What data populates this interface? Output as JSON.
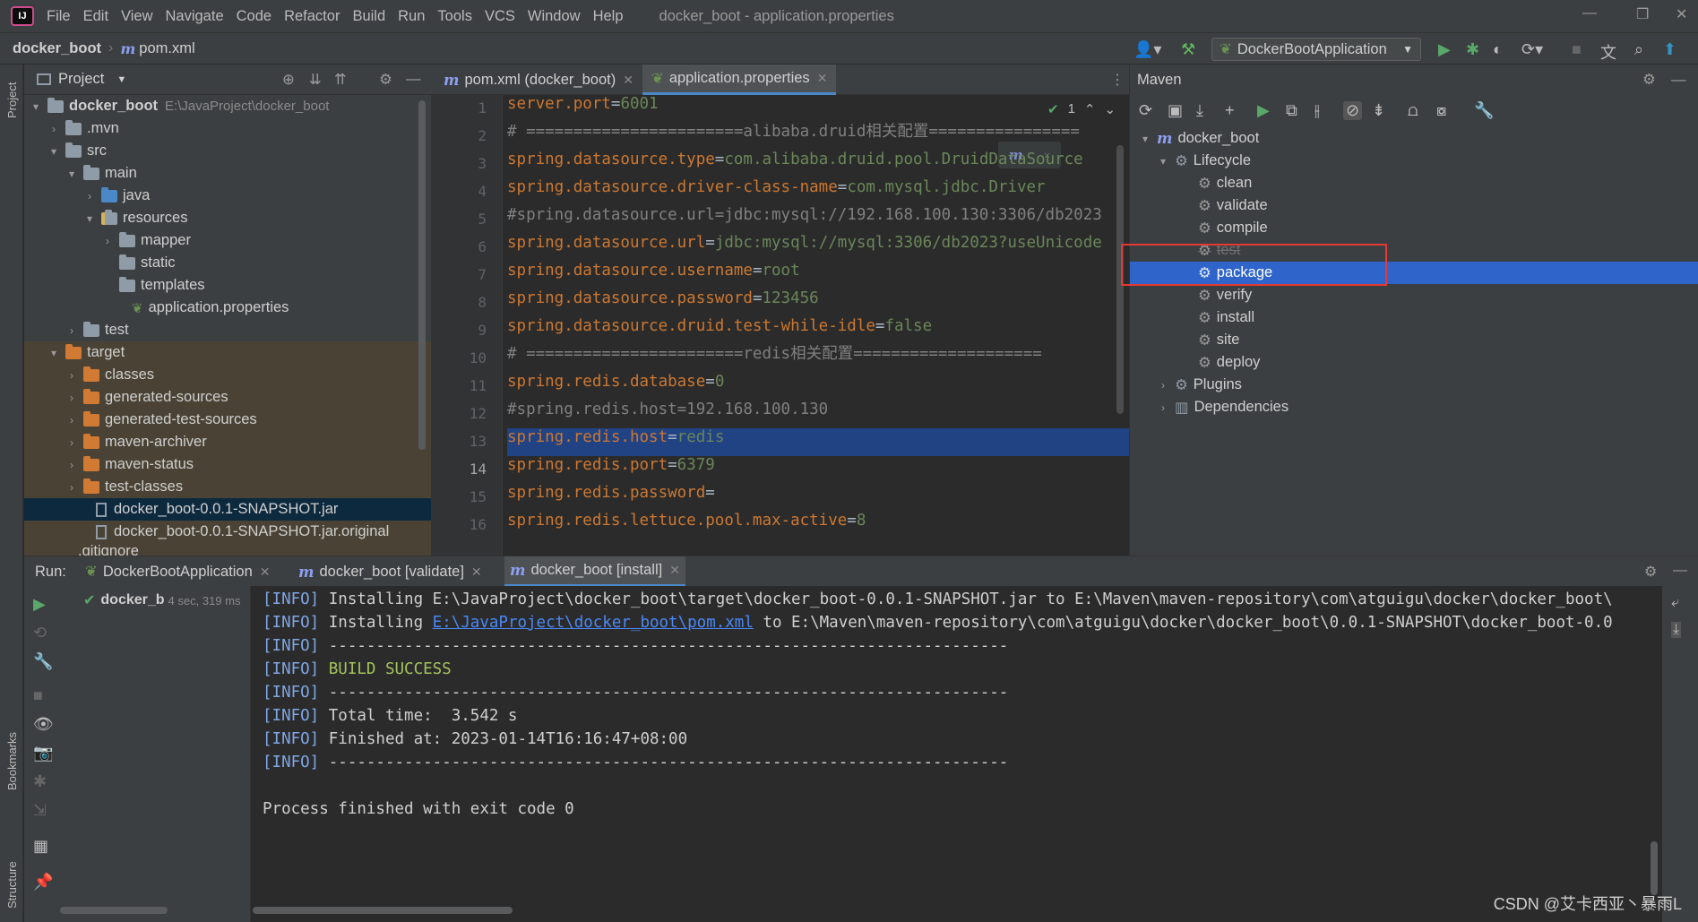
{
  "menubar": {
    "items": [
      "File",
      "Edit",
      "View",
      "Navigate",
      "Code",
      "Refactor",
      "Build",
      "Run",
      "Tools",
      "VCS",
      "Window",
      "Help"
    ],
    "window_title": "docker_boot - application.properties"
  },
  "navbar": {
    "project": "docker_boot",
    "file": "pom.xml",
    "run_config": "DockerBootApplication"
  },
  "left_stripe": {
    "project_label": "Project",
    "bookmarks_label": "Bookmarks",
    "structure_label": "Structure"
  },
  "project_panel": {
    "title": "Project",
    "root_name": "docker_boot",
    "root_path": "E:\\JavaProject\\docker_boot",
    "items": {
      "mvn": ".mvn",
      "src": "src",
      "main": "main",
      "java": "java",
      "resources": "resources",
      "mapper": "mapper",
      "static": "static",
      "templates": "templates",
      "app_props": "application.properties",
      "test": "test",
      "target": "target",
      "classes": "classes",
      "gen_sources": "generated-sources",
      "gen_test_sources": "generated-test-sources",
      "maven_archiver": "maven-archiver",
      "maven_status": "maven-status",
      "test_classes": "test-classes",
      "jar": "docker_boot-0.0.1-SNAPSHOT.jar",
      "jar_original": "docker_boot-0.0.1-SNAPSHOT.jar.original",
      "gitignore": ".gitignore"
    }
  },
  "editor": {
    "tabs": [
      "pom.xml (docker_boot)",
      "application.properties"
    ],
    "inspection_count": "1",
    "line_numbers": [
      "1",
      "2",
      "3",
      "4",
      "5",
      "6",
      "7",
      "8",
      "9",
      "10",
      "11",
      "12",
      "13",
      "14",
      "15",
      "16"
    ],
    "lines": [
      {
        "key": "server.port",
        "eq": "=",
        "val": "6001"
      },
      {
        "comment": "# =======================alibaba.druid相关配置================"
      },
      {
        "key": "spring.datasource.type",
        "eq": "=",
        "val": "com.alibaba.druid.pool.DruidDataSource"
      },
      {
        "key": "spring.datasource.driver-class-name",
        "eq": "=",
        "val": "com.mysql.jdbc.Driver"
      },
      {
        "comment": "#spring.datasource.url=jdbc:mysql://192.168.100.130:3306/db2023"
      },
      {
        "key": "spring.datasource.url",
        "eq": "=",
        "val": "jdbc:mysql://mysql:3306/db2023?useUnicode"
      },
      {
        "key": "spring.datasource.username",
        "eq": "=",
        "val": "root"
      },
      {
        "key": "spring.datasource.password",
        "eq": "=",
        "val": "123456"
      },
      {
        "key": "spring.datasource.druid.test-while-idle",
        "eq": "=",
        "val": "false"
      },
      {
        "comment": "# =======================redis相关配置===================="
      },
      {
        "key": "spring.redis.database",
        "eq": "=",
        "val": "0"
      },
      {
        "comment": "#spring.redis.host=192.168.100.130"
      },
      {
        "key": "spring.redis.host",
        "eq": "=",
        "val": "redis"
      },
      {
        "key": "spring.redis.port",
        "eq": "=",
        "val": "6379"
      },
      {
        "key": "spring.redis.password",
        "eq": "=",
        "val": ""
      },
      {
        "key": "spring.redis.lettuce.pool.max-active",
        "eq": "=",
        "val": "8"
      }
    ]
  },
  "maven": {
    "title": "Maven",
    "root": "docker_boot",
    "lifecycle": "Lifecycle",
    "phases": [
      "clean",
      "validate",
      "compile",
      "test",
      "package",
      "verify",
      "install",
      "site",
      "deploy"
    ],
    "selected_phase": "package",
    "plugins": "Plugins",
    "dependencies": "Dependencies",
    "highlight_color": "#e53935"
  },
  "run": {
    "label": "Run:",
    "tabs": [
      "DockerBootApplication",
      "docker_boot [validate]",
      "docker_boot [install]"
    ],
    "tree_item": "docker_b",
    "tree_time": "4 sec, 319 ms",
    "console": [
      {
        "tag": "[INFO]",
        "text": " Installing E:\\JavaProject\\docker_boot\\target\\docker_boot-0.0.1-SNAPSHOT.jar to E:\\Maven\\maven-repository\\com\\atguigu\\docker\\docker_boot\\"
      },
      {
        "tag": "[INFO]",
        "pre": " Installing ",
        "link": "E:\\JavaProject\\docker_boot\\pom.xml",
        "post": " to E:\\Maven\\maven-repository\\com\\atguigu\\docker\\docker_boot\\0.0.1-SNAPSHOT\\docker_boot-0.0"
      },
      {
        "tag": "[INFO]",
        "text": " ------------------------------------------------------------------------"
      },
      {
        "tag": "[INFO]",
        "success": " BUILD SUCCESS"
      },
      {
        "tag": "[INFO]",
        "text": " ------------------------------------------------------------------------"
      },
      {
        "tag": "[INFO]",
        "text": " Total time:  3.542 s"
      },
      {
        "tag": "[INFO]",
        "text": " Finished at: 2023-01-14T16:16:47+08:00"
      },
      {
        "tag": "[INFO]",
        "text": " ------------------------------------------------------------------------"
      },
      {
        "text": ""
      },
      {
        "text": "Process finished with exit code 0"
      }
    ]
  },
  "watermark": "CSDN @艾卡西亚丶暴雨L"
}
